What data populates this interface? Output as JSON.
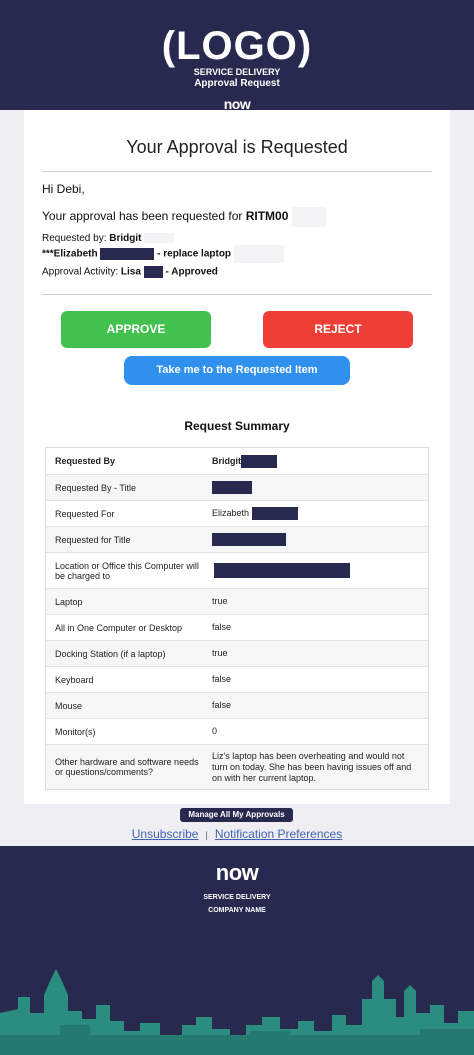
{
  "header": {
    "logo": "(LOGO)",
    "line1": "SERVICE DELIVERY",
    "line2": "Approval Request",
    "brand": "now"
  },
  "card": {
    "title": "Your Approval is Requested",
    "greeting": "Hi Debi,",
    "intro": "Your approval has been requested for ",
    "ritm": "RITM00",
    "requested_by_label": "Requested by: ",
    "requested_by_name": "Bridgit",
    "item_prefix": "***Elizabeth",
    "item_suffix": " - replace laptop",
    "activity_label": "Approval Activity: ",
    "activity_name": "Lisa",
    "activity_status": " - Approved"
  },
  "buttons": {
    "approve": "APPROVE",
    "reject": "REJECT",
    "take_me": "Take me to the Requested Item"
  },
  "summary": {
    "title": "Request Summary",
    "rows": [
      {
        "label": "Requested By",
        "value": "Bridgit"
      },
      {
        "label": "Requested By - Title",
        "value": ""
      },
      {
        "label": "Requested For",
        "value": "Elizabeth"
      },
      {
        "label": "Requested for Title",
        "value": ""
      },
      {
        "label": "Location or Office this Computer will be charged to",
        "value": ""
      },
      {
        "label": "Laptop",
        "value": "true"
      },
      {
        "label": "All in One Computer or Desktop",
        "value": "false"
      },
      {
        "label": "Docking Station (if a laptop)",
        "value": "true"
      },
      {
        "label": "Keyboard",
        "value": "false"
      },
      {
        "label": "Mouse",
        "value": "false"
      },
      {
        "label": "Monitor(s)",
        "value": "0"
      },
      {
        "label": "Other hardware and software needs or questions/comments?",
        "value": "Liz's laptop has been overheating and would not turn on today. She has been having issues off and on with her current laptop."
      }
    ]
  },
  "manage_link": "Manage All My Approvals",
  "links": {
    "unsubscribe": "Unsubscribe",
    "separator": "|",
    "preferences": "Notification Preferences"
  },
  "footer": {
    "brand": "now",
    "line1": "SERVICE DELIVERY",
    "line2": "COMPANY NAME"
  },
  "colors": {
    "navy": "#27294f",
    "approve": "#43c14f",
    "reject": "#ef3e36",
    "link_button": "#2f90ee",
    "skyline": "#2b8d80"
  }
}
